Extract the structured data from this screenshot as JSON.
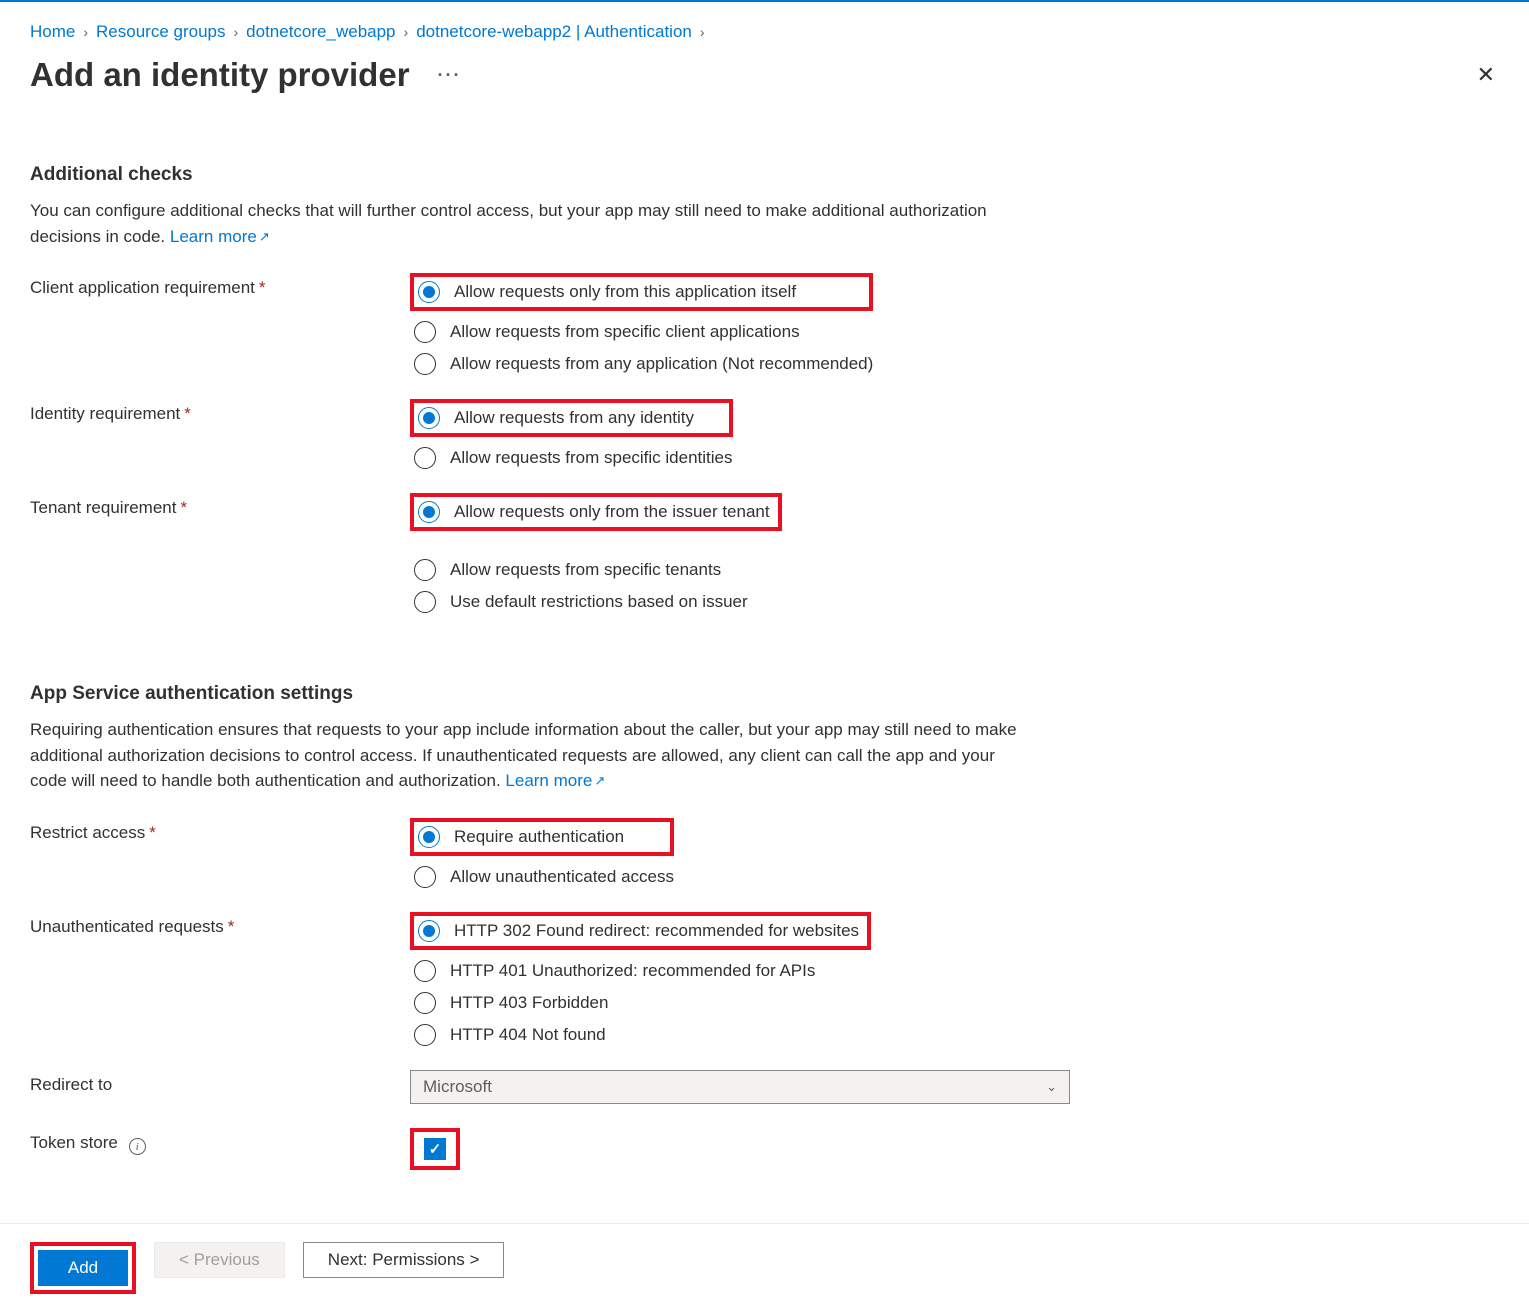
{
  "breadcrumb": {
    "items": [
      "Home",
      "Resource groups",
      "dotnetcore_webapp",
      "dotnetcore-webapp2 | Authentication"
    ]
  },
  "header": {
    "title": "Add an identity provider"
  },
  "section1": {
    "title": "Additional checks",
    "desc": "You can configure additional checks that will further control access, but your app may still need to make additional authorization decisions in code. ",
    "learn_more": "Learn more"
  },
  "section2": {
    "title": "App Service authentication settings",
    "desc": "Requiring authentication ensures that requests to your app include information about the caller, but your app may still need to make additional authorization decisions to control access. If unauthenticated requests are allowed, any client can call the app and your code will need to handle both authentication and authorization. ",
    "learn_more": "Learn more"
  },
  "fields": {
    "client_app_req": {
      "label": "Client application requirement",
      "opt1": "Allow requests only from this application itself",
      "opt2": "Allow requests from specific client applications",
      "opt3": "Allow requests from any application (Not recommended)"
    },
    "identity_req": {
      "label": "Identity requirement",
      "opt1": "Allow requests from any identity",
      "opt2": "Allow requests from specific identities"
    },
    "tenant_req": {
      "label": "Tenant requirement",
      "opt1": "Allow requests only from the issuer tenant",
      "opt2": "Allow requests from specific tenants",
      "opt3": "Use default restrictions based on issuer"
    },
    "restrict_access": {
      "label": "Restrict access",
      "opt1": "Require authentication",
      "opt2": "Allow unauthenticated access"
    },
    "unauth_requests": {
      "label": "Unauthenticated requests",
      "opt1": "HTTP 302 Found redirect: recommended for websites",
      "opt2": "HTTP 401 Unauthorized: recommended for APIs",
      "opt3": "HTTP 403 Forbidden",
      "opt4": "HTTP 404 Not found"
    },
    "redirect_to": {
      "label": "Redirect to",
      "value": "Microsoft"
    },
    "token_store": {
      "label": "Token store"
    }
  },
  "footer": {
    "add": "Add",
    "previous": "< Previous",
    "next": "Next: Permissions >"
  }
}
